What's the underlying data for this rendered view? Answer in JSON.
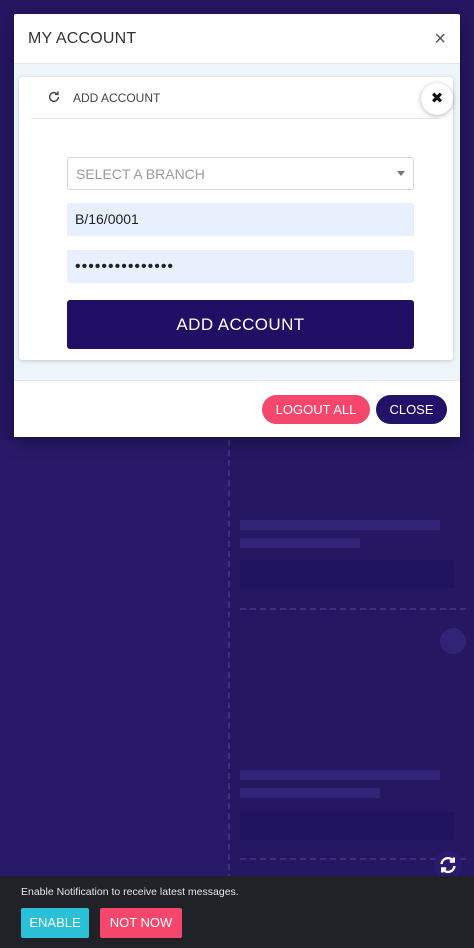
{
  "modal": {
    "title": "MY ACCOUNT",
    "close_glyph": "×"
  },
  "add_account_card": {
    "title": "ADD ACCOUNT",
    "close_glyph": "✖",
    "icon": "refresh-icon",
    "branch_select": {
      "placeholder": "SELECT A BRANCH",
      "value": ""
    },
    "username": {
      "value": "B/16/0001"
    },
    "password": {
      "value": "•••••••••••••••"
    },
    "submit_label": "ADD ACCOUNT"
  },
  "footer": {
    "logout_all_label": "LOGOUT ALL",
    "close_label": "CLOSE"
  },
  "notification": {
    "message": "Enable Notification to receive latest messages.",
    "enable_label": "ENABLE",
    "not_now_label": "NOT NOW"
  },
  "colors": {
    "primary": "#1f1065",
    "accent_pink": "#f5466c",
    "accent_cyan": "#2ac0d7",
    "background": "#2b1b6f"
  }
}
